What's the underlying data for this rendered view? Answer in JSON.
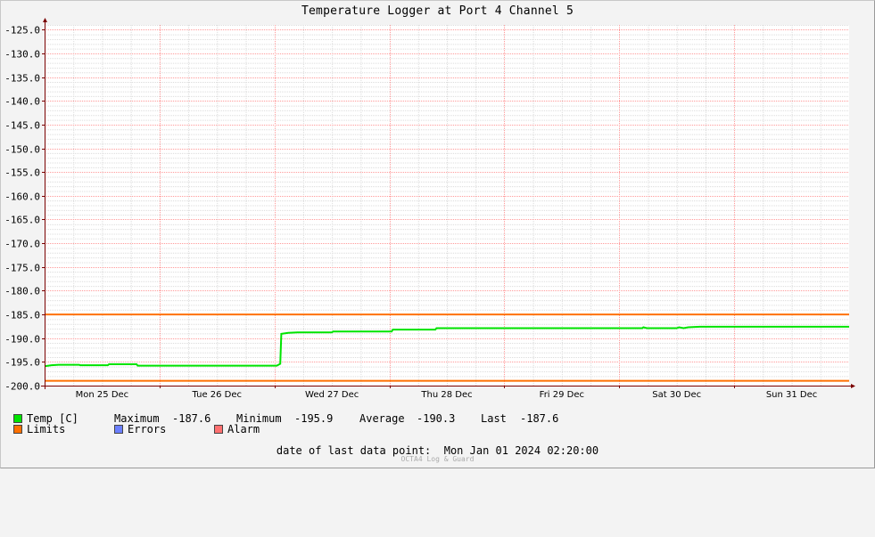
{
  "chart_data": {
    "type": "line",
    "title": "Temperature Logger at Port 4 Channel 5",
    "ylim": [
      -200,
      -124
    ],
    "y_ticks": [
      "-125.0",
      "-130.0",
      "-135.0",
      "-140.0",
      "-145.0",
      "-150.0",
      "-155.0",
      "-160.0",
      "-165.0",
      "-170.0",
      "-175.0",
      "-180.0",
      "-185.0",
      "-190.0",
      "-195.0",
      "-200.0"
    ],
    "x_ticks": [
      "Mon 25 Dec",
      "Tue 26 Dec",
      "Wed 27 Dec",
      "Thu 28 Dec",
      "Fri 29 Dec",
      "Sat 30 Dec",
      "Sun 31 Dec"
    ],
    "x_range_days": [
      0,
      7.0
    ],
    "grid": true,
    "colors": {
      "temp": "#00e400",
      "limits": "#ff7000",
      "errors": "#6b7fff",
      "alarm": "#ff7070",
      "grid": "#ff9a9a",
      "axis": "#7a0000",
      "plot_bg": "#ffffff",
      "page_bg": "#f3f3f3"
    },
    "series": [
      {
        "key": "temp",
        "name": "Temp [C]",
        "points": [
          [
            0.0,
            -195.9
          ],
          [
            0.06,
            -195.7
          ],
          [
            0.12,
            -195.6
          ],
          [
            0.3,
            -195.6
          ],
          [
            0.31,
            -195.7
          ],
          [
            0.55,
            -195.7
          ],
          [
            0.56,
            -195.5
          ],
          [
            0.8,
            -195.5
          ],
          [
            0.81,
            -195.8
          ],
          [
            1.0,
            -195.8
          ],
          [
            1.5,
            -195.8
          ],
          [
            2.02,
            -195.8
          ],
          [
            2.05,
            -195.4
          ],
          [
            2.06,
            -189.1
          ],
          [
            2.12,
            -188.9
          ],
          [
            2.2,
            -188.8
          ],
          [
            2.5,
            -188.8
          ],
          [
            2.51,
            -188.6
          ],
          [
            3.02,
            -188.6
          ],
          [
            3.03,
            -188.2
          ],
          [
            3.4,
            -188.2
          ],
          [
            3.41,
            -187.9
          ],
          [
            4.0,
            -187.9
          ],
          [
            5.0,
            -187.9
          ],
          [
            5.2,
            -187.9
          ],
          [
            5.21,
            -187.7
          ],
          [
            5.24,
            -187.9
          ],
          [
            5.5,
            -187.9
          ],
          [
            5.52,
            -187.7
          ],
          [
            5.56,
            -187.9
          ],
          [
            5.6,
            -187.7
          ],
          [
            5.7,
            -187.6
          ],
          [
            6.5,
            -187.6
          ],
          [
            7.0,
            -187.6
          ]
        ]
      },
      {
        "key": "limits",
        "name": "Limits",
        "lines": [
          -185.0,
          -199.0
        ]
      }
    ]
  },
  "legend": {
    "temp_label": "Temp [C]",
    "maximum_label": "Maximum",
    "maximum_value": "-187.6",
    "minimum_label": "Minimum",
    "minimum_value": "-195.9",
    "average_label": "Average",
    "average_value": "-190.3",
    "last_label": "Last",
    "last_value": "-187.6",
    "limits_label": "Limits",
    "errors_label": "Errors",
    "alarm_label": "Alarm"
  },
  "footer": {
    "date_label": "date of last data point:",
    "date_value": "Mon Jan 01 2024 02:20:00",
    "credit": "OCTA4 Log & Guard"
  }
}
